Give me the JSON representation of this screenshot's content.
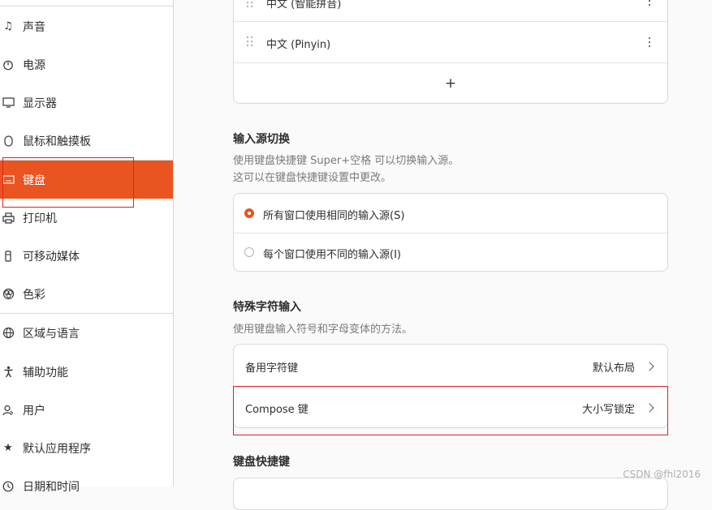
{
  "sidebar": {
    "items": [
      {
        "label": "声音",
        "icon": "music-note-icon"
      },
      {
        "label": "电源",
        "icon": "power-icon"
      },
      {
        "label": "显示器",
        "icon": "display-icon"
      },
      {
        "label": "鼠标和触摸板",
        "icon": "mouse-icon"
      },
      {
        "label": "键盘",
        "icon": "keyboard-icon",
        "active": true
      },
      {
        "label": "打印机",
        "icon": "printer-icon"
      },
      {
        "label": "可移动媒体",
        "icon": "removable-media-icon"
      },
      {
        "label": "色彩",
        "icon": "color-icon"
      },
      {
        "label": "区域与语言",
        "icon": "globe-icon"
      },
      {
        "label": "辅助功能",
        "icon": "accessibility-icon"
      },
      {
        "label": "用户",
        "icon": "user-icon"
      },
      {
        "label": "默认应用程序",
        "icon": "star-icon"
      },
      {
        "label": "日期和时间",
        "icon": "clock-icon"
      }
    ],
    "accent_color": "#e95420"
  },
  "input_sources": {
    "items": [
      {
        "label": "中文 (智能拼音)"
      },
      {
        "label": "中文 (Pinyin)"
      }
    ],
    "add_label": "+"
  },
  "switching": {
    "title": "输入源切换",
    "desc_line1": "使用键盘快捷键 Super+空格 可以切换输入源。",
    "desc_line2": "这可以在键盘快捷键设置中更改。",
    "options": [
      {
        "label": "所有窗口使用相同的输入源(S)",
        "selected": true
      },
      {
        "label": "每个窗口使用不同的输入源(I)",
        "selected": false
      }
    ]
  },
  "special_chars": {
    "title": "特殊字符输入",
    "desc": "使用键盘输入符号和字母变体的方法。",
    "rows": [
      {
        "label": "备用字符键",
        "value": "默认布局"
      },
      {
        "label": "Compose 键",
        "value": "大小写锁定"
      }
    ]
  },
  "shortcuts": {
    "title": "键盘快捷键"
  },
  "watermark": "CSDN @fhl2016",
  "highlight_color": "#e0202a"
}
